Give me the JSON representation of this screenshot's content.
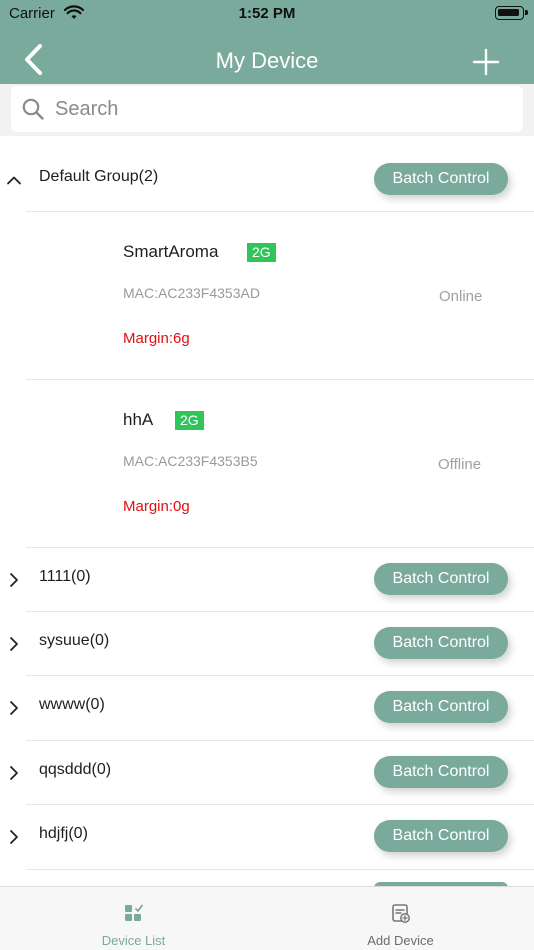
{
  "status_bar": {
    "carrier": "Carrier",
    "time": "1:52 PM"
  },
  "nav": {
    "title": "My Device",
    "back_icon": "chevron-left-icon",
    "add_icon": "plus-icon"
  },
  "search": {
    "placeholder": "Search"
  },
  "colors": {
    "accent": "#7aaa9c",
    "badge": "#2fc55a",
    "margin_text": "#e10f0f"
  },
  "groups": [
    {
      "name": "Default Group(2)",
      "expanded": true,
      "button": "Batch Control",
      "devices": [
        {
          "name": "SmartAroma",
          "band": "2G",
          "mac": "MAC:AC233F4353AD",
          "status": "Online",
          "margin": "Margin:6g"
        },
        {
          "name": "hhA",
          "band": "2G",
          "mac": "MAC:AC233F4353B5",
          "status": "Offline",
          "margin": "Margin:0g"
        }
      ]
    },
    {
      "name": "1111(0)",
      "expanded": false,
      "button": "Batch Control"
    },
    {
      "name": "sysuue(0)",
      "expanded": false,
      "button": "Batch Control"
    },
    {
      "name": "wwww(0)",
      "expanded": false,
      "button": "Batch Control"
    },
    {
      "name": "qqsddd(0)",
      "expanded": false,
      "button": "Batch Control"
    },
    {
      "name": "hdjfj(0)",
      "expanded": false,
      "button": "Batch Control"
    }
  ],
  "tabs": [
    {
      "label": "Device List",
      "active": true,
      "icon": "device-list-icon"
    },
    {
      "label": "Add Device",
      "active": false,
      "icon": "add-device-icon"
    }
  ]
}
